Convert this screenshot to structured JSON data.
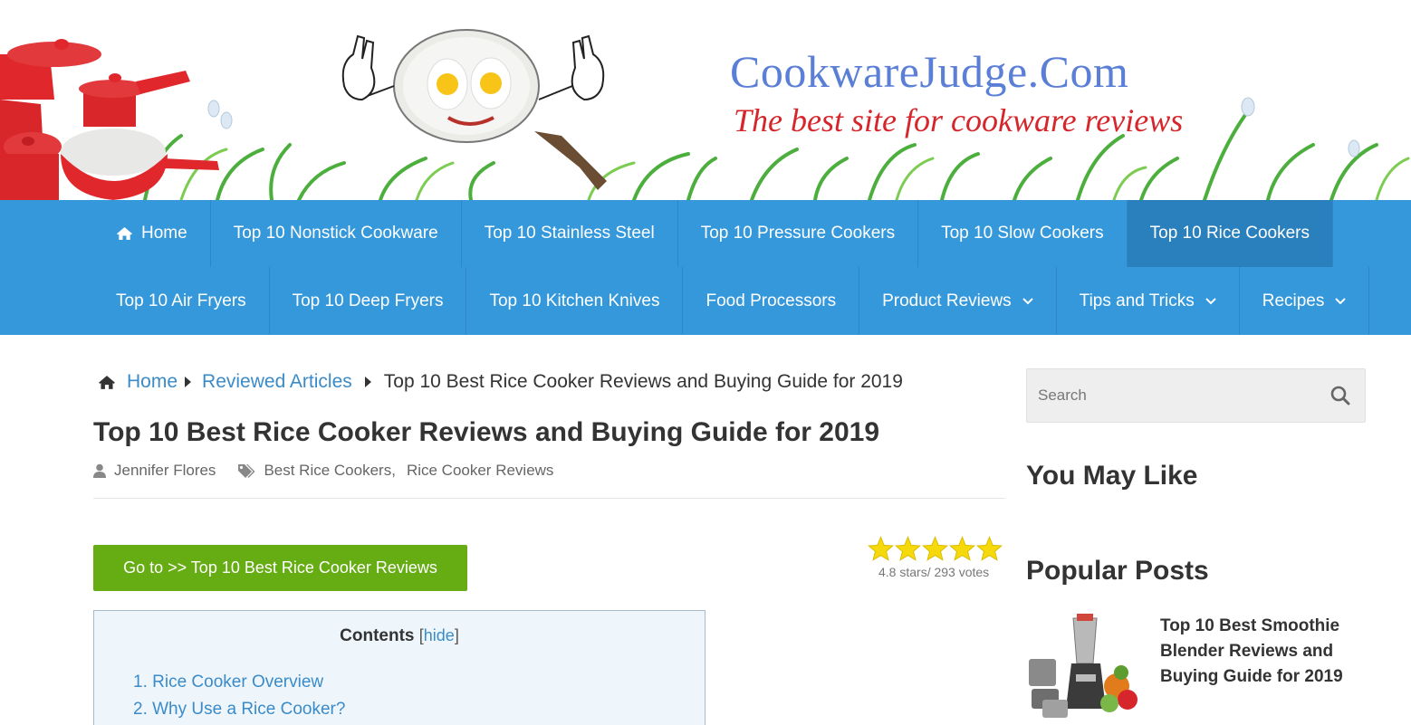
{
  "header": {
    "site_title": "CookwareJudge.Com",
    "tagline": "The best site for cookware reviews"
  },
  "nav": {
    "row1": [
      {
        "label": "Home",
        "icon": "home-icon"
      },
      {
        "label": "Top 10 Nonstick Cookware"
      },
      {
        "label": "Top 10 Stainless Steel"
      },
      {
        "label": "Top 10 Pressure Cookers"
      },
      {
        "label": "Top 10 Slow Cookers"
      },
      {
        "label": "Top 10 Rice Cookers",
        "active": true
      }
    ],
    "row2": [
      {
        "label": "Top 10 Air Fryers"
      },
      {
        "label": "Top 10 Deep Fryers"
      },
      {
        "label": "Top 10 Kitchen Knives"
      },
      {
        "label": "Food Processors"
      },
      {
        "label": "Product Reviews",
        "dropdown": true
      },
      {
        "label": "Tips and Tricks",
        "dropdown": true
      },
      {
        "label": "Recipes",
        "dropdown": true
      }
    ]
  },
  "breadcrumb": {
    "home": "Home",
    "section": "Reviewed Articles",
    "current": "Top 10 Best Rice Cooker Reviews and Buying Guide for 2019"
  },
  "post": {
    "title": "Top 10 Best Rice Cooker Reviews and Buying Guide for 2019",
    "author": "Jennifer Flores",
    "tag1": "Best Rice Cookers,",
    "tag2": "Rice Cooker Reviews",
    "goto_button": "Go to >> Top 10 Best Rice Cooker Reviews"
  },
  "rating": {
    "stars": 5,
    "text": "4.8 stars/ 293 votes",
    "star_color": "#f5d90a"
  },
  "toc": {
    "title": "Contents",
    "bracket_open": "[",
    "hide_label": "hide",
    "bracket_close": "]",
    "items": [
      "1. Rice Cooker Overview",
      "2. Why Use a Rice Cooker?"
    ]
  },
  "sidebar": {
    "search_placeholder": "Search",
    "you_may_like": "You May Like",
    "popular_posts": "Popular Posts",
    "popular_item_title": "Top 10 Best Smoothie Blender Reviews and Buying Guide for 2019"
  },
  "colors": {
    "nav_bg": "#3498db",
    "nav_active": "#2a80bd",
    "link": "#3a8bc8",
    "button_green": "#66ac13",
    "title_blue": "#5b7fd6",
    "tagline_red": "#d7262b"
  }
}
